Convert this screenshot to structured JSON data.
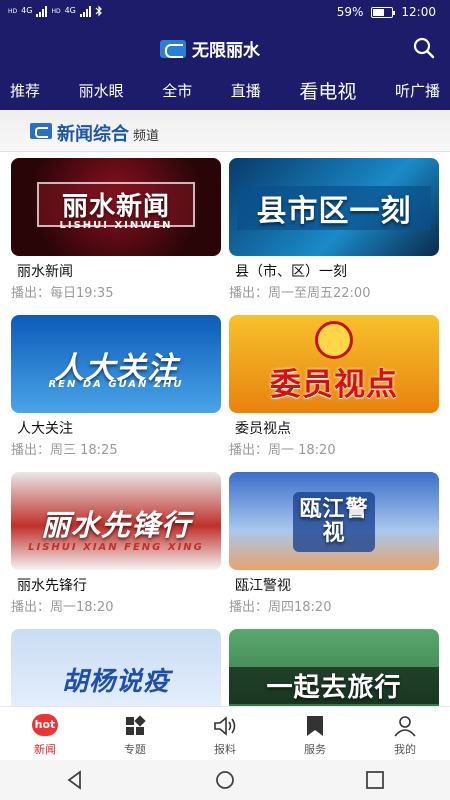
{
  "status_bar": {
    "signal_labels": [
      "HD",
      "HD"
    ],
    "network": "4G",
    "battery_percent": "59%",
    "battery_level": 0.59,
    "time": "12:00"
  },
  "header": {
    "app_name": "无限丽水",
    "search_icon": "search-icon"
  },
  "tabs": [
    {
      "label": "推荐"
    },
    {
      "label": "丽水眼"
    },
    {
      "label": "全市"
    },
    {
      "label": "直播"
    },
    {
      "label": "看电视"
    },
    {
      "label": "听广播"
    }
  ],
  "channel": {
    "logo_text": "LSTV",
    "title": "新闻综合",
    "suffix": "频道"
  },
  "programs": [
    {
      "thumb_text": "丽水新闻",
      "thumb_sub": "LISHUI XINWEN",
      "name": "丽水新闻",
      "time": "播出：每日19:35"
    },
    {
      "thumb_text": "县市区一刻",
      "thumb_sub": "",
      "name": "县（市、区）一刻",
      "time": "播出：周一至周五22:00"
    },
    {
      "thumb_text": "人大关注",
      "thumb_sub": "REN DA GUAN ZHU",
      "name": "人大关注",
      "time": "播出：周三 18:25"
    },
    {
      "thumb_text": "委员视点",
      "thumb_sub": "",
      "name": "委员视点",
      "time": "播出：周一 18:20"
    },
    {
      "thumb_text": "丽水先锋行",
      "thumb_sub": "LISHUI XIAN FENG XING",
      "name": "丽水先锋行",
      "time": "播出：周一18:20"
    },
    {
      "thumb_text": "瓯江警视",
      "thumb_sub": "",
      "name": "瓯江警视",
      "time": "播出：周四18:20"
    },
    {
      "thumb_text": "胡杨说疫",
      "thumb_sub": "",
      "name": "",
      "time": ""
    },
    {
      "thumb_text": "一起去旅行",
      "thumb_sub": "",
      "name": "",
      "time": ""
    }
  ],
  "bottom_nav": [
    {
      "label": "新闻",
      "icon": "hot-news-icon",
      "badge": "hot",
      "active": true
    },
    {
      "label": "专题",
      "icon": "grid-icon",
      "active": false
    },
    {
      "label": "报料",
      "icon": "speaker-icon",
      "active": false
    },
    {
      "label": "服务",
      "icon": "bookmark-icon",
      "active": false
    },
    {
      "label": "我的",
      "icon": "user-icon",
      "active": false
    }
  ],
  "system_nav": [
    "back-icon",
    "home-icon",
    "recents-icon"
  ],
  "colors": {
    "header_bg": "#1c1c6b",
    "active_nav": "#e02a2a",
    "channel_title": "#1b56a8",
    "meta_text": "#999999"
  }
}
